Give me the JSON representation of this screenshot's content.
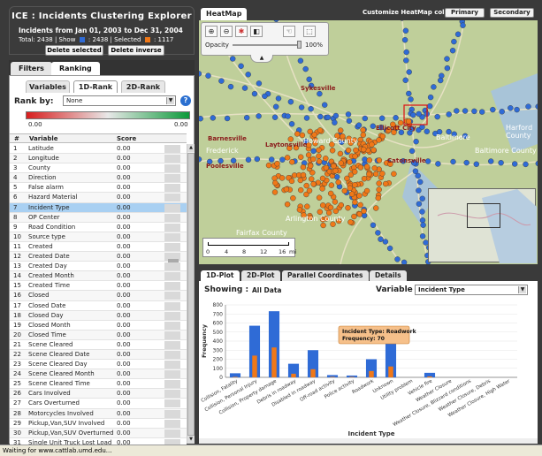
{
  "app": {
    "title": "ICE : Incidents Clustering Explorer",
    "range_prefix": "Incidents from",
    "range_start": "Jan 01, 2003",
    "range_mid": "to",
    "range_end": "Dec 31, 2004",
    "total_label": "Total: 2438 | Show",
    "show_count": ": 2438 | Selected",
    "selected_count": ": 1117",
    "delete_selected": "Delete selected",
    "delete_inverse": "Delete inverse"
  },
  "left_tabs": [
    "Filters",
    "Ranking"
  ],
  "rank_tabs": [
    "Variables",
    "1D-Rank",
    "2D-Rank"
  ],
  "rank_by": {
    "label": "Rank by:",
    "value": "None"
  },
  "gradient": {
    "min": "0.00",
    "max": "0.00"
  },
  "table": {
    "headers": [
      "#",
      "Variable",
      "Score"
    ],
    "selected_index": 6,
    "rows": [
      {
        "n": "1",
        "v": "Latitude",
        "s": "0.00"
      },
      {
        "n": "2",
        "v": "Longitude",
        "s": "0.00"
      },
      {
        "n": "3",
        "v": "County",
        "s": "0.00"
      },
      {
        "n": "4",
        "v": "Direction",
        "s": "0.00"
      },
      {
        "n": "5",
        "v": "False alarm",
        "s": "0.00"
      },
      {
        "n": "6",
        "v": "Hazard Material",
        "s": "0.00"
      },
      {
        "n": "7",
        "v": "Incident Type",
        "s": "0.00"
      },
      {
        "n": "8",
        "v": "OP Center",
        "s": "0.00"
      },
      {
        "n": "9",
        "v": "Road Condition",
        "s": "0.00"
      },
      {
        "n": "10",
        "v": "Source type",
        "s": "0.00"
      },
      {
        "n": "11",
        "v": "Created",
        "s": "0.00"
      },
      {
        "n": "12",
        "v": "Created Date",
        "s": "0.00"
      },
      {
        "n": "13",
        "v": "Created Day",
        "s": "0.00"
      },
      {
        "n": "14",
        "v": "Created Month",
        "s": "0.00"
      },
      {
        "n": "15",
        "v": "Created Time",
        "s": "0.00"
      },
      {
        "n": "16",
        "v": "Closed",
        "s": "0.00"
      },
      {
        "n": "17",
        "v": "Closed Date",
        "s": "0.00"
      },
      {
        "n": "18",
        "v": "Closed Day",
        "s": "0.00"
      },
      {
        "n": "19",
        "v": "Closed Month",
        "s": "0.00"
      },
      {
        "n": "20",
        "v": "Closed Time",
        "s": "0.00"
      },
      {
        "n": "21",
        "v": "Scene Cleared",
        "s": "0.00"
      },
      {
        "n": "22",
        "v": "Scene Cleared Date",
        "s": "0.00"
      },
      {
        "n": "23",
        "v": "Scene Cleared Day",
        "s": "0.00"
      },
      {
        "n": "24",
        "v": "Scene Cleared Month",
        "s": "0.00"
      },
      {
        "n": "25",
        "v": "Scene Cleared Time",
        "s": "0.00"
      },
      {
        "n": "26",
        "v": "Cars Involved",
        "s": "0.00"
      },
      {
        "n": "27",
        "v": "Cars Overturned",
        "s": "0.00"
      },
      {
        "n": "28",
        "v": "Motorcycles Involved",
        "s": "0.00"
      },
      {
        "n": "29",
        "v": "Pickup,Van,SUV Involved",
        "s": "0.00"
      },
      {
        "n": "30",
        "v": "Pickup,Van,SUV Overturned",
        "s": "0.00"
      },
      {
        "n": "31",
        "v": "Single Unit Truck Lost Load",
        "s": "0.00"
      }
    ]
  },
  "map": {
    "tab": "HeatMap",
    "customize_label": "Customize HeatMap color :",
    "primary": "Primary",
    "secondary": "Secondary",
    "opacity_label": "Opacity",
    "opacity_value": "100%",
    "scale_labels": [
      "0",
      "4",
      "8",
      "12",
      "16",
      "mi"
    ],
    "places": [
      "Frederick",
      "Sykesville",
      "Ellicott City",
      "Baltimore",
      "Catonsville",
      "Harford County",
      "Baltimore County",
      "Barnesville",
      "Laytonsville",
      "Howard County",
      "Poolesville",
      "Fairfax County",
      "Arlington County"
    ]
  },
  "plot": {
    "tabs": [
      "1D-Plot",
      "2D-Plot",
      "Parallel Coordinates",
      "Details"
    ],
    "showing_label": "Showing :",
    "showing_value": "All Data",
    "variable_label": "Variable :",
    "variable_value": "Incident Type",
    "tooltip_type": "Incident Type: Roadwork",
    "tooltip_freq": "Frequency: 70"
  },
  "chart_data": {
    "type": "bar",
    "xlabel": "Incident Type",
    "ylabel": "Frequency",
    "ylim": [
      0,
      800
    ],
    "yticks": [
      0,
      100,
      200,
      300,
      400,
      500,
      600,
      700,
      800
    ],
    "categories": [
      "Collision, Fatality",
      "Collision, Personal Injury",
      "Collision, Property damage",
      "Debris in roadway",
      "Disabled in roadway",
      "Off-road activity",
      "Police activity",
      "Roadwork",
      "Unknown",
      "Utility problem",
      "Vehicle fire",
      "Weather Closure",
      "Weather Closure, Blizzard conditions",
      "Weather Closure, Debris",
      "Weather Closure, High Water"
    ],
    "series": [
      {
        "values": [
          45,
          570,
          730,
          150,
          300,
          25,
          20,
          200,
          440,
          0,
          50,
          0,
          0,
          0,
          0
        ]
      },
      {
        "values": [
          5,
          240,
          330,
          40,
          90,
          5,
          5,
          70,
          120,
          0,
          10,
          0,
          0,
          0,
          0
        ]
      }
    ],
    "colors": [
      "#2f6bd6",
      "#f07818"
    ]
  },
  "status": "Waiting for www.cattlab.umd.edu..."
}
